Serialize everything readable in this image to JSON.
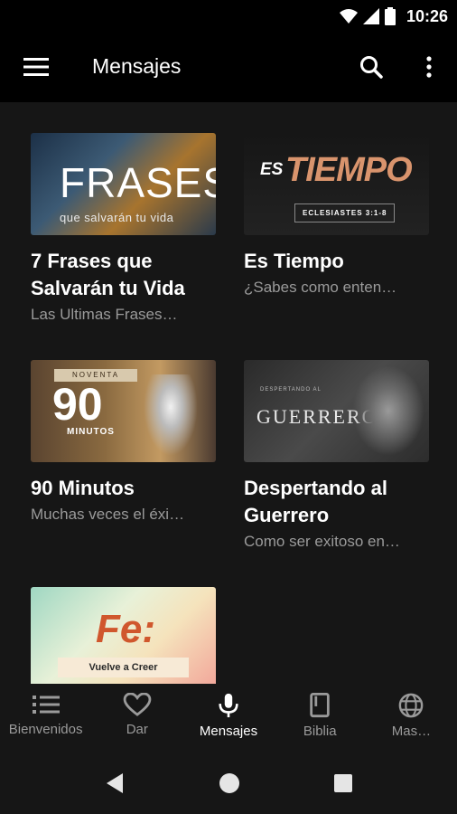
{
  "status_bar": {
    "time": "10:26"
  },
  "app_bar": {
    "title": "Mensajes"
  },
  "cards": [
    {
      "title": "7 Frases que Salvarán tu Vida",
      "subtitle": "Las Ultimas Frases…",
      "thumb_big": "FRASES",
      "thumb_small": "que salvarán tu vida"
    },
    {
      "title": "Es Tiempo",
      "subtitle": "¿Sabes como enten…",
      "thumb_es": "ES",
      "thumb_tiempo": "TIEMPO",
      "thumb_ref": "ECLESIASTES 3:1-8"
    },
    {
      "title": "90 Minutos",
      "subtitle": "Muchas veces el éxi…",
      "thumb_nov": "NOVENTA",
      "thumb_num": "90",
      "thumb_min": "MINUTOS"
    },
    {
      "title": "Despertando al Guerrero",
      "subtitle": "Como ser exitoso en…",
      "thumb_pre": "DESPERTANDO AL",
      "thumb_word": "GUERRERO"
    },
    {
      "title": "",
      "subtitle": "",
      "thumb_fe": "Fe:",
      "thumb_band": "Vuelve a Creer"
    }
  ],
  "bottom_nav": [
    {
      "label": "Bienvenidos",
      "icon": "list-icon"
    },
    {
      "label": "Dar",
      "icon": "heart-icon"
    },
    {
      "label": "Mensajes",
      "icon": "microphone-icon",
      "active": true
    },
    {
      "label": "Biblia",
      "icon": "book-icon"
    },
    {
      "label": "Mas…",
      "icon": "globe-icon"
    }
  ],
  "colors": {
    "background": "#161616",
    "bar": "#000000",
    "subtext": "#9a9a9a",
    "accent_thumb": "#d9946d"
  }
}
